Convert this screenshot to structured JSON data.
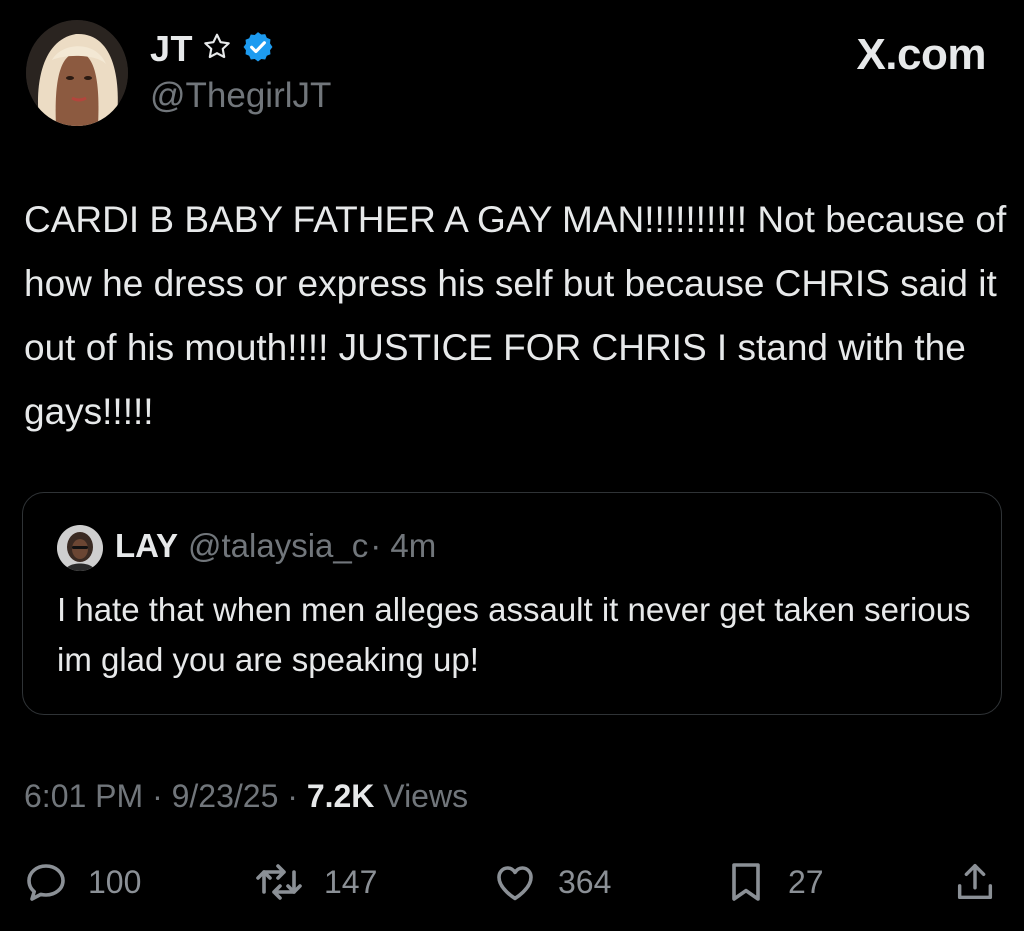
{
  "author": {
    "display_name": "JT",
    "handle": "@ThegirlJT",
    "avatar_icon": "profile-photo-blonde",
    "badges": [
      "star-outline-icon",
      "verified-badge-icon"
    ],
    "verified_color": "#1d9bf0"
  },
  "brand": {
    "label": "X.com"
  },
  "tweet": {
    "text": "CARDI B  BABY FATHER A GAY MAN!!!!!!!!!! Not because of how he dress or express his self but because CHRIS said it out of his mouth!!!! JUSTICE FOR CHRIS I stand with the gays!!!!!"
  },
  "quoted_tweet": {
    "display_name": "LAY",
    "handle": "@talaysia_c",
    "time": "· 4m",
    "text": "I hate that when men alleges assault it never get taken serious im glad you are speaking up!"
  },
  "meta": {
    "time": "6:01 PM",
    "sep1": " · ",
    "date": "9/23/25",
    "sep2": " · ",
    "views_count": "7.2K",
    "views_label": "Views"
  },
  "actions": {
    "replies": "100",
    "reposts": "147",
    "likes": "364",
    "bookmarks": "27"
  },
  "colors": {
    "background": "#000000",
    "text": "#e7e9ea",
    "secondary": "#71767b",
    "border": "#2f3336"
  }
}
